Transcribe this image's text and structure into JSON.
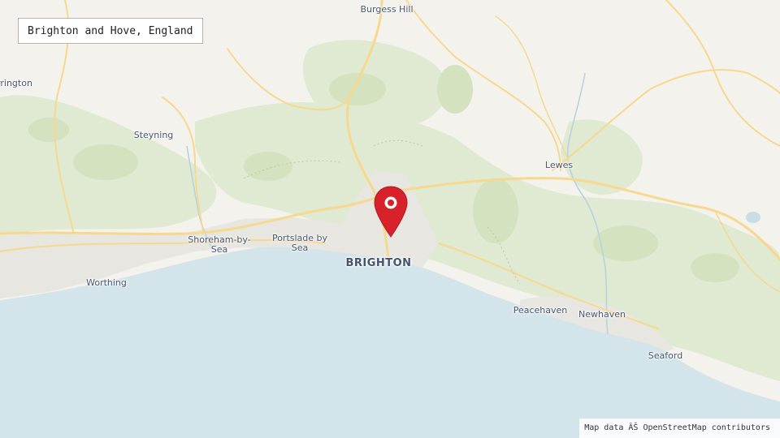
{
  "title": "Brighton and Hove, England",
  "attribution": "Map data ÂŠ OpenStreetMap contributors",
  "marker": {
    "icon": "map-pin-icon",
    "color": "#d7222b"
  },
  "colors": {
    "sea": "#d3e5ea",
    "land": "#f4f2ec",
    "green": "#dfe8cf",
    "road": "#f7d991",
    "label": "#4a5872"
  },
  "places": [
    {
      "id": "burgess-hill",
      "name": "Burgess Hill"
    },
    {
      "id": "storrington",
      "name": "rrington"
    },
    {
      "id": "steyning",
      "name": "Steyning"
    },
    {
      "id": "lewes",
      "name": "Lewes"
    },
    {
      "id": "shoreham",
      "name": "Shoreham-by-\nSea"
    },
    {
      "id": "portslade",
      "name": "Portslade by\nSea"
    },
    {
      "id": "brighton",
      "name": "BRIGHTON"
    },
    {
      "id": "worthing",
      "name": "Worthing"
    },
    {
      "id": "peacehaven",
      "name": "Peacehaven"
    },
    {
      "id": "newhaven",
      "name": "Newhaven"
    },
    {
      "id": "seaford",
      "name": "Seaford"
    }
  ]
}
